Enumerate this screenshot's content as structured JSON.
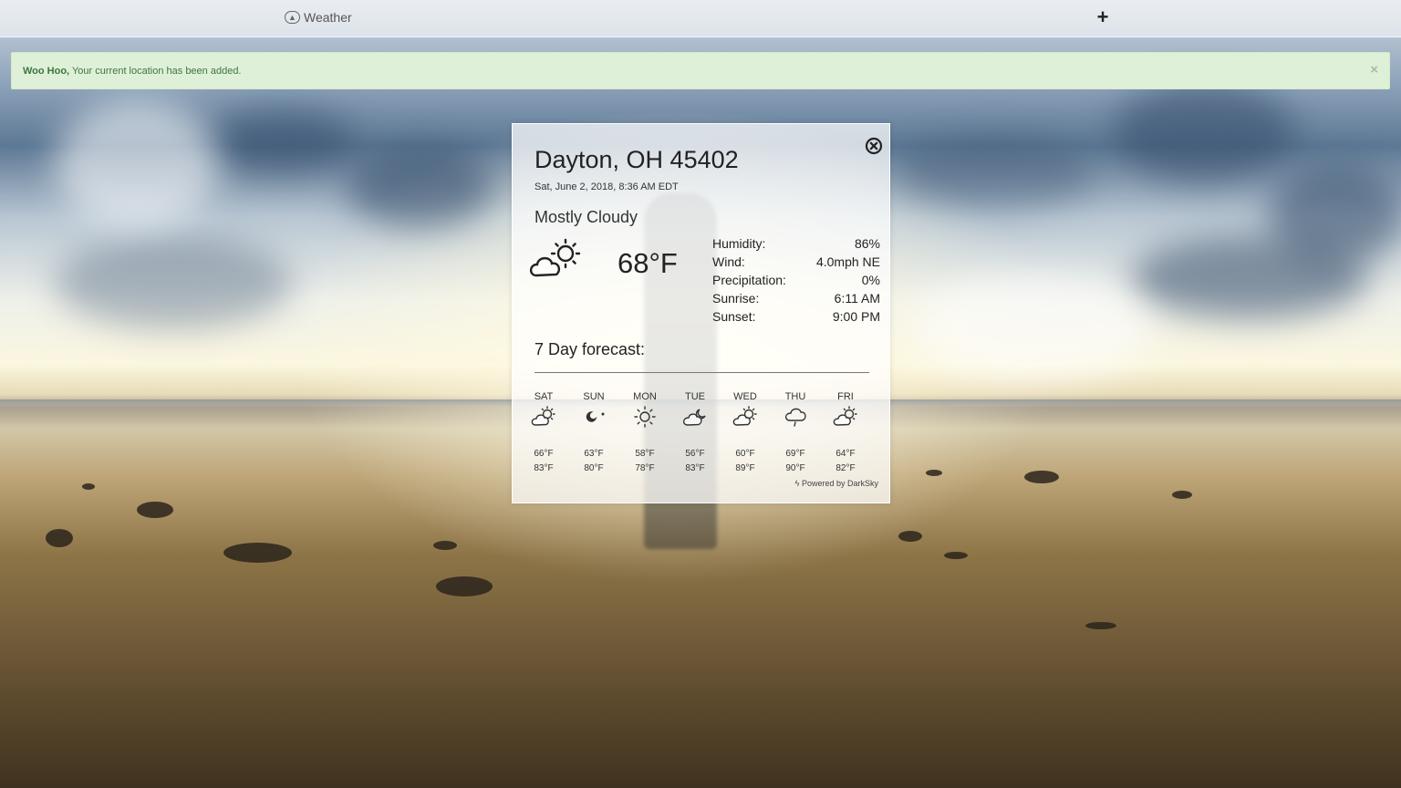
{
  "topbar": {
    "brand_label": "Weather",
    "brand_icon": "weather-logo-icon",
    "add_label": "+"
  },
  "alert": {
    "strong": "Woo Hoo,",
    "message": " Your current location has been added.",
    "close_label": "×",
    "color": "#3c763d",
    "background": "#dff0d8"
  },
  "weather": {
    "location": "Dayton, OH 45402",
    "datetime": "Sat, June 2, 2018, 8:36 AM EDT",
    "condition": "Mostly Cloudy",
    "icon": "partly-cloudy-day-icon",
    "temperature": "68°F",
    "stats": [
      {
        "label": "Humidity:",
        "value": "86%"
      },
      {
        "label": "Wind:",
        "value": "4.0mph NE"
      },
      {
        "label": "Precipitation:",
        "value": "0%"
      },
      {
        "label": "Sunrise:",
        "value": "6:11 AM"
      },
      {
        "label": "Sunset:",
        "value": "9:00 PM"
      }
    ],
    "forecast_title": "7 Day forecast:",
    "forecast": [
      {
        "day": "SAT",
        "icon": "partly-cloudy-icon",
        "low": "66°F",
        "high": "83°F"
      },
      {
        "day": "SUN",
        "icon": "clear-night-icon",
        "low": "63°F",
        "high": "80°F"
      },
      {
        "day": "MON",
        "icon": "clear-day-icon",
        "low": "58°F",
        "high": "78°F"
      },
      {
        "day": "TUE",
        "icon": "partly-cloudy-night-icon",
        "low": "56°F",
        "high": "83°F"
      },
      {
        "day": "WED",
        "icon": "partly-cloudy-icon",
        "low": "60°F",
        "high": "89°F"
      },
      {
        "day": "THU",
        "icon": "rain-icon",
        "low": "69°F",
        "high": "90°F"
      },
      {
        "day": "FRI",
        "icon": "partly-cloudy-icon",
        "low": "64°F",
        "high": "82°F"
      }
    ],
    "powered_by": "Powered by DarkSky"
  }
}
